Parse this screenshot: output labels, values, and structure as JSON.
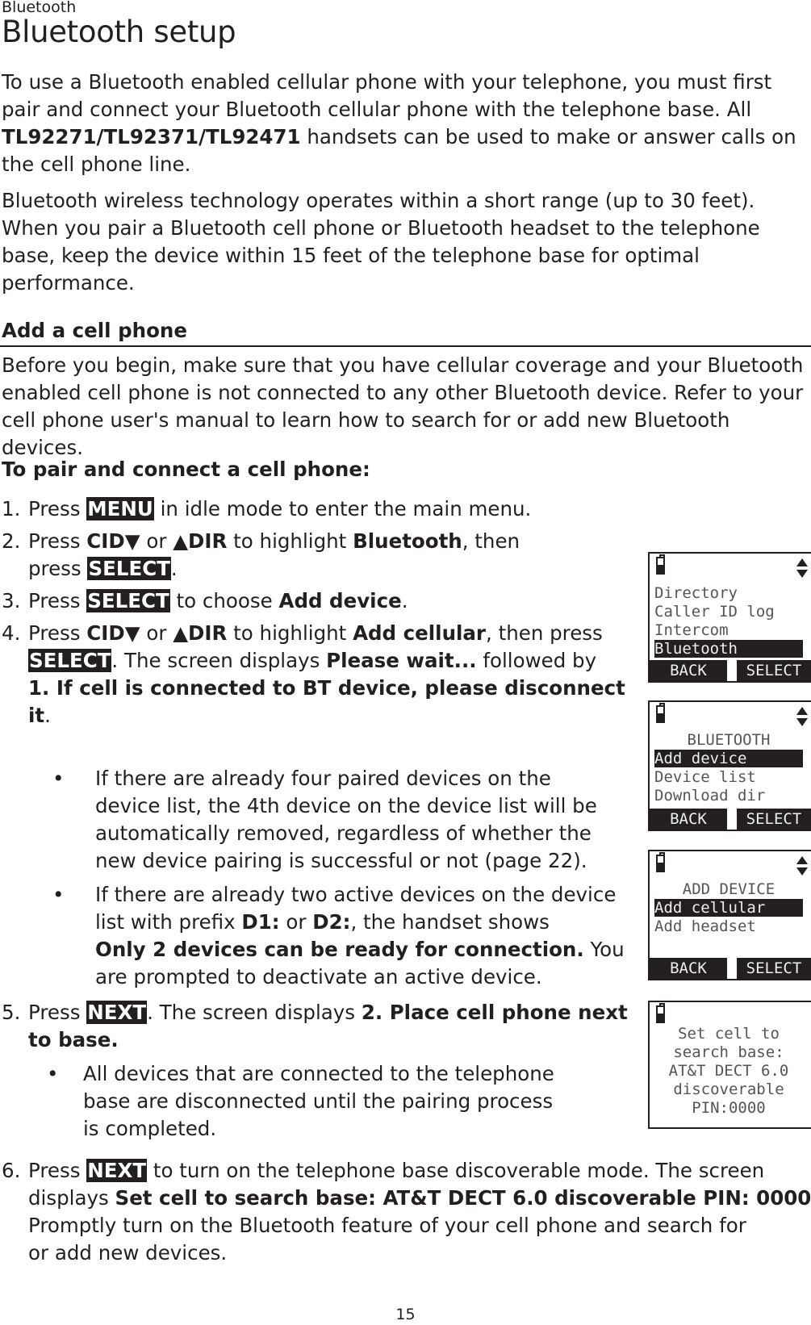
{
  "header": {
    "section": "Bluetooth",
    "title": "Bluetooth setup"
  },
  "intro": {
    "p1_before": "To use a Bluetooth enabled cellular phone with your telephone, you must first pair and connect your Bluetooth cellular phone with the telephone base. All ",
    "p1_models": "TL92271/TL92371/TL92471",
    "p1_after": " handsets can be used to make or answer calls on the cell phone line.",
    "p2": "Bluetooth wireless technology operates within a short range (up to 30 feet). When you pair a Bluetooth cell phone or Bluetooth headset to the telephone base, keep the device within 15 feet of the telephone base for optimal performance."
  },
  "add_cell": {
    "heading": "Add a cell phone",
    "body": "Before you begin, make sure that you have cellular coverage and your Bluetooth enabled cell phone is not connected to any other Bluetooth device. Refer to your cell phone user's manual to learn how to search for or add new Bluetooth devices.",
    "subheading": "To pair and connect a cell phone:"
  },
  "steps": {
    "s1": {
      "num": "1.",
      "a": "Press ",
      "key": "MENU",
      "b": " in idle mode to enter the main menu."
    },
    "s2": {
      "num": "2.",
      "a": "Press ",
      "cid": "CID▼",
      "or": " or ",
      "dir": "▲DIR",
      "b": " to highlight ",
      "target": "Bluetooth",
      "c": ", then",
      "d": "press ",
      "key": "SELECT",
      "e": "."
    },
    "s3": {
      "num": "3.",
      "a": "Press ",
      "key": "SELECT",
      "b": " to choose ",
      "target": "Add device",
      "c": "."
    },
    "s4": {
      "num": "4.",
      "a": "Press ",
      "cid": "CID▼",
      "or": " or ",
      "dir": "▲DIR",
      "b": " to highlight ",
      "target": "Add cellular",
      "c": ", then press",
      "key": "SELECT",
      "d": ". The screen displays ",
      "wait": "Please wait...",
      "e": " followed by",
      "msg1": "1. If cell is connected to BT device, please disconnect",
      "msg2": "it",
      "f": ".",
      "bullets": [
        {
          "dot": "•",
          "lines": [
            "If there are already four paired devices on the",
            "device list, the 4th device on the device list will be",
            "automatically removed, regardless of whether the",
            "new device pairing is successful or not (page 22)."
          ]
        },
        {
          "dot": "•",
          "l1": "If there are already two active devices on the device",
          "l2a": "list with prefix ",
          "d1": "D1:",
          "l2b": " or ",
          "d2": "D2:",
          "l2c": ", the handset shows",
          "l3b": "Only 2 devices can be ready for connection.",
          "l3c": " You",
          "l4": "are prompted to deactivate an active device."
        }
      ]
    },
    "s5": {
      "num": "5.",
      "a": "Press ",
      "key": "NEXT",
      "b": ". The screen displays ",
      "msg1": "2. Place cell phone next",
      "msg2": "to base.",
      "bullet": {
        "dot": "•",
        "lines": [
          "All devices that are connected to the telephone",
          "base are disconnected until the pairing process",
          "is completed."
        ]
      }
    },
    "s6": {
      "num": "6.",
      "a": "Press ",
      "key": "NEXT",
      "b": " to turn on the telephone base discoverable mode. The screen",
      "c": "displays ",
      "msg": "Set cell to search base: AT&T DECT 6.0 discoverable PIN: 0000.",
      "d": "Promptly turn on the Bluetooth feature of your cell phone and search for",
      "e": "or add new devices."
    }
  },
  "screens": [
    {
      "icon": "battery-icon",
      "lines": [
        "Directory",
        "Caller ID log",
        "Intercom",
        "Bluetooth"
      ],
      "selected": 3,
      "softkeys": [
        "BACK",
        "SELECT"
      ]
    },
    {
      "icon": "battery-icon",
      "title": "BLUETOOTH",
      "lines": [
        "Add device",
        "Device list",
        "Download dir"
      ],
      "selected": 0,
      "softkeys": [
        "BACK",
        "SELECT"
      ]
    },
    {
      "icon": "battery-icon",
      "title": "ADD DEVICE",
      "lines": [
        "Add cellular",
        "Add headset"
      ],
      "selected": 0,
      "softkeys": [
        "BACK",
        "SELECT"
      ]
    },
    {
      "icon": "battery-icon",
      "lines": [
        "Set cell to",
        "search base:",
        "AT&T DECT 6.0",
        "discoverable",
        "PIN:0000"
      ]
    }
  ],
  "footer": {
    "page_number": "15"
  }
}
